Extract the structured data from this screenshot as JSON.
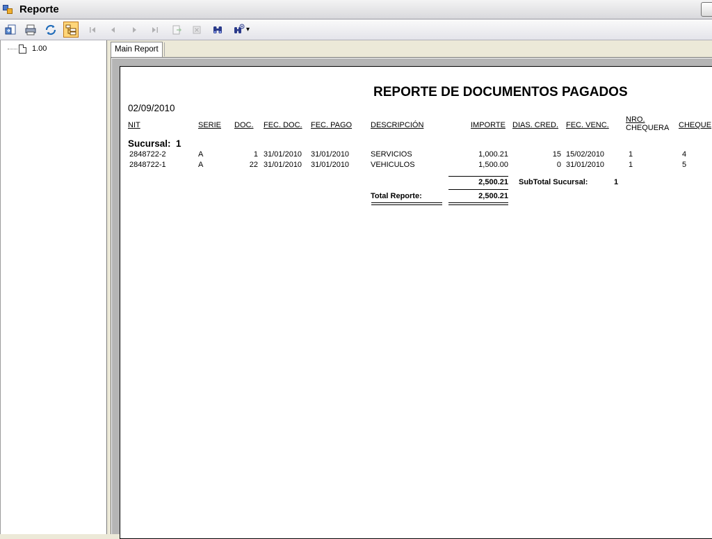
{
  "window": {
    "title": "Reporte"
  },
  "toolbar": {
    "buttons": [
      {
        "name": "export-icon"
      },
      {
        "name": "print-icon"
      },
      {
        "name": "refresh-icon"
      },
      {
        "name": "group-tree-icon",
        "active": true
      },
      {
        "name": "first-page-icon"
      },
      {
        "name": "previous-page-icon"
      },
      {
        "name": "next-page-icon"
      },
      {
        "name": "last-page-icon"
      },
      {
        "name": "go-to-page-icon"
      },
      {
        "name": "stop-icon"
      },
      {
        "name": "search-icon"
      },
      {
        "name": "zoom-icon"
      }
    ],
    "zoom_dropdown_glyph": "▾"
  },
  "tree": {
    "node_label": "1.00"
  },
  "tabs": {
    "main": "Main Report"
  },
  "report": {
    "title": "REPORTE DE DOCUMENTOS PAGADOS",
    "date": "02/09/2010",
    "headers": {
      "nit": "NIT",
      "serie": "SERIE",
      "doc": "DOC.",
      "fec_doc": "FEC. DOC.",
      "fec_pago": "FEC. PAGO",
      "descripcion": "DESCRIPCIÓN",
      "importe": "IMPORTE",
      "dias_cred": "DIAS. CRED.",
      "fec_venc": "FEC. VENC.",
      "nro_line1": "NRO.",
      "nro_line2": "CHEQUERA",
      "cheque": "CHEQUE"
    },
    "group": {
      "label": "Sucursal:",
      "value": "1"
    },
    "rows": [
      {
        "nit": "2848722-2",
        "serie": "A",
        "doc": "1",
        "fec_doc": "31/01/2010",
        "fec_pago": "31/01/2010",
        "descripcion": "SERVICIOS",
        "importe": "1,000.21",
        "dias_cred": "15",
        "fec_venc": "15/02/2010",
        "nro_chequera": "1",
        "cheque": "4"
      },
      {
        "nit": "2848722-1",
        "serie": "A",
        "doc": "22",
        "fec_doc": "31/01/2010",
        "fec_pago": "31/01/2010",
        "descripcion": "VEHICULOS",
        "importe": "1,500.00",
        "dias_cred": "0",
        "fec_venc": "31/01/2010",
        "nro_chequera": "1",
        "cheque": "5"
      }
    ],
    "subtotal": {
      "value": "2,500.21",
      "label": "SubTotal Sucursal:",
      "group_value": "1"
    },
    "total": {
      "label": "Total Reporte:",
      "value": "2,500.21"
    }
  }
}
